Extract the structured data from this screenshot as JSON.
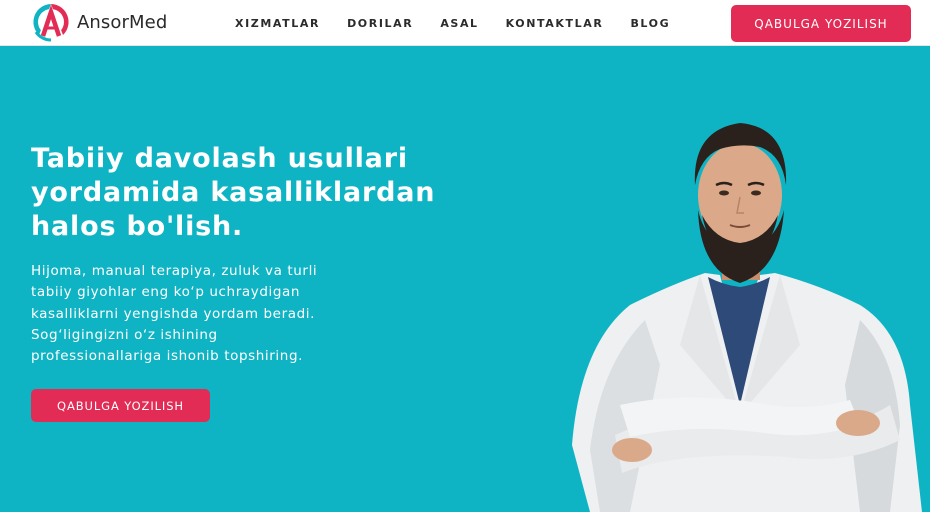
{
  "header": {
    "brand": "AnsorMed",
    "nav": [
      {
        "label": "XIZMATLAR"
      },
      {
        "label": "DORILAR"
      },
      {
        "label": "ASAL"
      },
      {
        "label": "KONTAKTLAR"
      },
      {
        "label": "BLOG"
      }
    ],
    "cta_label": "QABULGA YOZILISH"
  },
  "hero": {
    "title_lines": [
      "Tabiiy davolash usullari",
      "yordamida kasalliklardan",
      "halos bo'lish."
    ],
    "description_lines": [
      "Hijoma, manual terapiya, zuluk va turli",
      "tabiiy giyohlar eng koʻp uchraydigan",
      "kasalliklarni yengishda yordam beradi.",
      "Sogʻligingizni oʻz ishining",
      "professionallariga ishonib topshiring."
    ],
    "cta_label": "QABULGA YOZILISH"
  },
  "colors": {
    "accent": "#e22c55",
    "hero_background": "#0fb4c4",
    "header_background": "#ffffff"
  },
  "icons": {
    "logo": "ansormed-logo-icon"
  }
}
